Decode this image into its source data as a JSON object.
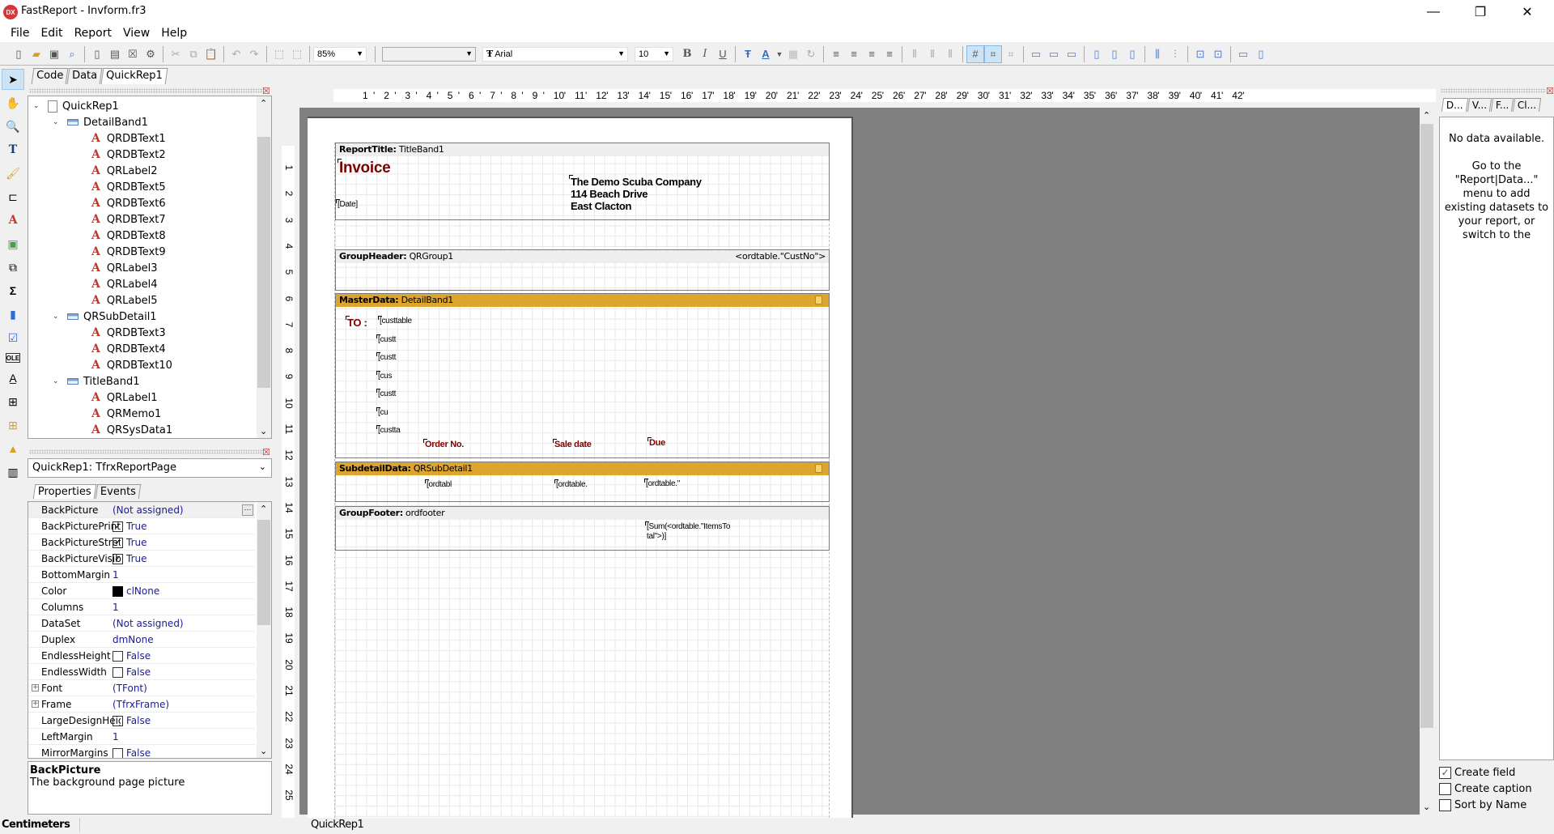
{
  "window": {
    "title": "FastReport - Invform.fr3",
    "logo": "DX",
    "minimize": "—",
    "restore": "❐",
    "close": "✕"
  },
  "menu": [
    "File",
    "Edit",
    "Report",
    "View",
    "Help"
  ],
  "toolbar": {
    "zoom": "85%",
    "style": "",
    "font_name": "Arial",
    "font_size": "10",
    "bold": "B",
    "italic": "I",
    "underline": "U"
  },
  "doc_tabs": [
    "Code",
    "Data",
    "QuickRep1"
  ],
  "tree": {
    "root": "QuickRep1",
    "groups": [
      {
        "name": "DetailBand1",
        "children": [
          "QRDBText1",
          "QRDBText2",
          "QRLabel2",
          "QRDBText5",
          "QRDBText6",
          "QRDBText7",
          "QRDBText8",
          "QRDBText9",
          "QRLabel3",
          "QRLabel4",
          "QRLabel5"
        ]
      },
      {
        "name": "QRSubDetail1",
        "children": [
          "QRDBText3",
          "QRDBText4",
          "QRDBText10"
        ]
      },
      {
        "name": "TitleBand1",
        "children": [
          "QRLabel1",
          "QRMemo1",
          "QRSysData1"
        ]
      }
    ]
  },
  "inspector": {
    "object": "QuickRep1: TfrxReportPage",
    "tabs": [
      "Properties",
      "Events"
    ],
    "properties": [
      {
        "name": "BackPicture",
        "value": "(Not assigned)",
        "kind": "text",
        "selected": true
      },
      {
        "name": "BackPicturePrintable",
        "value": "True",
        "kind": "check",
        "checked": true
      },
      {
        "name": "BackPictureStretched",
        "value": "True",
        "kind": "check",
        "checked": true
      },
      {
        "name": "BackPictureVisible",
        "value": "True",
        "kind": "check",
        "checked": true
      },
      {
        "name": "BottomMargin",
        "value": "1",
        "kind": "text"
      },
      {
        "name": "Color",
        "value": "clNone",
        "kind": "color",
        "color": "#000000"
      },
      {
        "name": "Columns",
        "value": "1",
        "kind": "text"
      },
      {
        "name": "DataSet",
        "value": "(Not assigned)",
        "kind": "text"
      },
      {
        "name": "Duplex",
        "value": "dmNone",
        "kind": "text"
      },
      {
        "name": "EndlessHeight",
        "value": "False",
        "kind": "check",
        "checked": false
      },
      {
        "name": "EndlessWidth",
        "value": "False",
        "kind": "check",
        "checked": false
      },
      {
        "name": "Font",
        "value": "(TFont)",
        "kind": "expand"
      },
      {
        "name": "Frame",
        "value": "(TfrxFrame)",
        "kind": "expand"
      },
      {
        "name": "LargeDesignHeight",
        "value": "False",
        "kind": "check",
        "checked": false
      },
      {
        "name": "LeftMargin",
        "value": "1",
        "kind": "text"
      },
      {
        "name": "MirrorMargins",
        "value": "False",
        "kind": "check",
        "checked": false
      }
    ],
    "description_title": "BackPicture",
    "description_text": "The background page picture"
  },
  "status": {
    "units": "Centimeters",
    "page": "QuickRep1"
  },
  "ruler": {
    "h_numbers": [
      1,
      2,
      3,
      4,
      5,
      6,
      7,
      8,
      9,
      10,
      11,
      12,
      13,
      14,
      15,
      16,
      17,
      18,
      19,
      20,
      21,
      22,
      23,
      24,
      25,
      26,
      27,
      28,
      29,
      30,
      31,
      32,
      33,
      34,
      35,
      36,
      37,
      38,
      39,
      40,
      41,
      42
    ],
    "v_numbers": [
      1,
      2,
      3,
      4,
      5,
      6,
      7,
      8,
      9,
      10,
      11,
      12,
      13,
      14,
      15,
      16,
      17,
      18,
      19,
      20,
      21,
      22,
      23,
      24,
      25
    ]
  },
  "report": {
    "title_band": {
      "type": "ReportTitle:",
      "name": "TitleBand1",
      "invoice": "Invoice",
      "date": "[Date]",
      "company": [
        "The Demo Scuba Company",
        "114 Beach Drive",
        "East Clacton"
      ]
    },
    "group_header": {
      "type": "GroupHeader:",
      "name": "QRGroup1",
      "condition": "<ordtable.\"CustNo\">"
    },
    "master_data": {
      "type": "MasterData:",
      "name": "DetailBand1",
      "to_label": "TO :",
      "fields": [
        "[custtable",
        "[custt",
        "[custt",
        "[cus",
        "[custt",
        "[cu",
        "[custta"
      ],
      "headers": [
        "Order No.",
        "Sale date",
        "Due"
      ]
    },
    "subdetail": {
      "type": "SubdetailData:",
      "name": "QRSubDetail1",
      "fields": [
        "[ordtabl",
        "[ordtable.",
        "[ordtable.\""
      ]
    },
    "group_footer": {
      "type": "GroupFooter:",
      "name": "ordfooter",
      "sum_line1": "[Sum(<ordtable.\"ItemsTo",
      "sum_line2": "tal\">)]"
    },
    "accent_color": "#dda42e",
    "label_color": "#800000"
  },
  "data_panel": {
    "tabs": [
      "D...",
      "V...",
      "F...",
      "Cl..."
    ],
    "message_title": "No data available.",
    "message_body": "Go to the \"Report|Data...\" menu to add existing datasets to your report, or switch to the",
    "options": [
      {
        "label": "Create field",
        "checked": true
      },
      {
        "label": "Create caption",
        "checked": false
      },
      {
        "label": "Sort by Name",
        "checked": false
      }
    ]
  }
}
